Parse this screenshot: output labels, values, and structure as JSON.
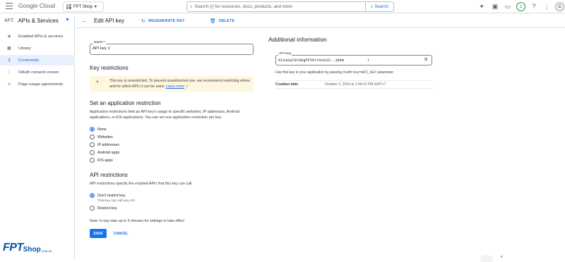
{
  "topbar": {
    "logo": "Google Cloud",
    "project": "FPT Shop",
    "search_placeholder": "Search (/) for resources, docs, products, and more",
    "search_button": "Search",
    "notification_count": "2",
    "avatar_letter": "C"
  },
  "sidebar": {
    "api_label": "API",
    "title": "APIs & Services",
    "items": [
      {
        "label": "Enabled APIs & services",
        "icon": "grid-icon"
      },
      {
        "label": "Library",
        "icon": "library-icon"
      },
      {
        "label": "Credentials",
        "icon": "key-icon"
      },
      {
        "label": "OAuth consent screen",
        "icon": "consent-icon"
      },
      {
        "label": "Page usage agreements",
        "icon": "settings-list-icon"
      }
    ]
  },
  "header": {
    "title": "Edit API key",
    "regenerate": "REGENERATE KEY",
    "delete": "DELETE"
  },
  "form": {
    "name_label": "Name *",
    "name_value": "API key 1",
    "key_restrictions_title": "Key restrictions",
    "warning_text": "This key is unrestricted. To prevent unauthorized use, we recommend restricting where and for which APIs it can be used.",
    "warning_link": "Learn more",
    "app_restriction_title": "Set an application restriction",
    "app_restriction_desc": "Application restrictions limit an API key's usage to specific websites, IP addresses, Android applications, or iOS applications. You can set one application restriction per key.",
    "app_options": [
      "None",
      "Websites",
      "IP addresses",
      "Android apps",
      "iOS apps"
    ],
    "app_selected": "None",
    "api_restrictions_title": "API restrictions",
    "api_restrictions_desc": "API restrictions specify the enabled APIs that this key can call",
    "api_options": [
      "Don't restrict key",
      "Restrict key"
    ],
    "api_selected": "Don't restrict key",
    "api_option_sub": "This key can call any API",
    "note": "Note: It may take up to 5 minutes for settings to take effect",
    "save": "SAVE",
    "cancel": "CANCEL"
  },
  "info": {
    "title": "Additional information",
    "api_key_label": "API Key",
    "api_key_value": "AIzaSyCGYaDgFPYKrVXx6iZ--jNKm",
    "hint_prefix": "Use this key in your application by passing it with",
    "hint_code": "key=API_KEY",
    "hint_suffix": "parameter.",
    "created_label": "Creation date",
    "created_value": "October 3, 2024 at 1:46:41 PM GMT+7"
  },
  "watermark": {
    "brand": "FPT",
    "shop": "Shop",
    "domain": ".com.vn"
  }
}
